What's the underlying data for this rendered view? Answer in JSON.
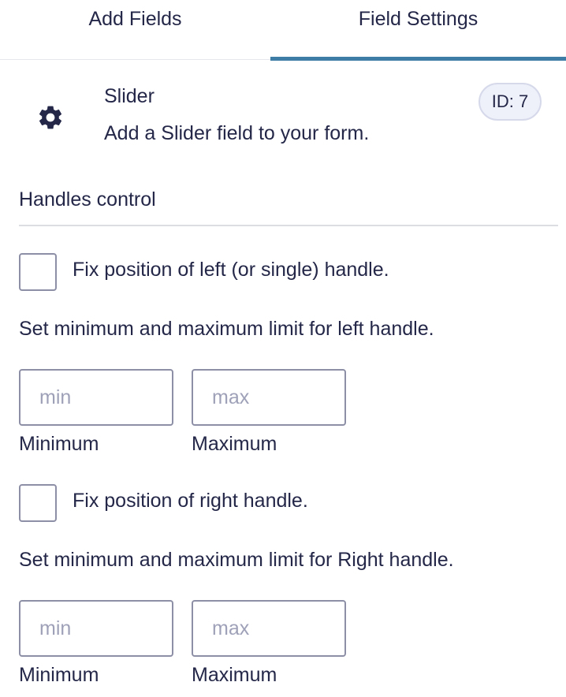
{
  "tabs": {
    "add_fields": "Add Fields",
    "field_settings": "Field Settings"
  },
  "field": {
    "title": "Slider",
    "description": "Add a Slider field to your form.",
    "id_badge": "ID: 7",
    "icon": "gear-icon"
  },
  "handles": {
    "heading": "Handles control",
    "left": {
      "fix_label": "Fix position of left (or single) handle.",
      "checked": false,
      "help": "Set minimum and maximum limit for left handle.",
      "min_placeholder": "min",
      "max_placeholder": "max",
      "min_value": "",
      "max_value": "",
      "min_label": "Minimum",
      "max_label": "Maximum"
    },
    "right": {
      "fix_label": "Fix position of right handle.",
      "checked": false,
      "help": "Set minimum and maximum limit for Right handle.",
      "min_placeholder": "min",
      "max_placeholder": "max",
      "min_value": "",
      "max_value": "",
      "min_label": "Minimum",
      "max_label": "Maximum"
    }
  },
  "colors": {
    "accent": "#3e7da6",
    "text": "#242748",
    "border": "#8d8fa6",
    "badge_bg": "#eef0fa"
  }
}
